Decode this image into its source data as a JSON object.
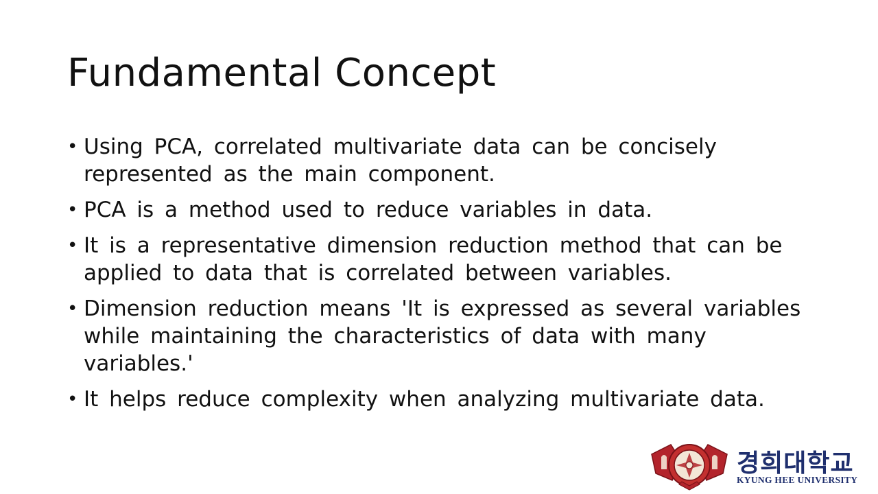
{
  "slide": {
    "title": "Fundamental Concept",
    "bullet_glyph": "•",
    "bullets": [
      "Using PCA, correlated multivariate data can be concisely represented as the main component.",
      "PCA is a method used to reduce variables in data.",
      "It is a representative dimension reduction method that can be applied to data that is correlated between variables.",
      "Dimension reduction means 'It is expressed as several variables while maintaining the characteristics of data with many variables.'",
      "It helps reduce complexity when analyzing multivariate data."
    ]
  },
  "logo": {
    "name_korean": "경희대학교",
    "name_english": "KYUNG HEE UNIVERSITY",
    "brand_color": "#1f2f6e",
    "seal_color": "#b3242c",
    "seal_icon": "university-seal-icon"
  }
}
